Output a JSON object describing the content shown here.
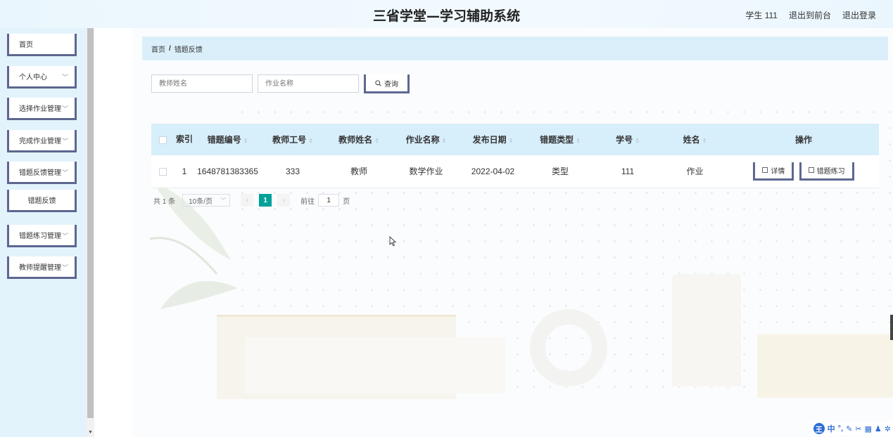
{
  "header": {
    "title": "三省学堂—学习辅助系统",
    "user_label": "学生 111",
    "back_to_front": "退出到前台",
    "logout": "退出登录"
  },
  "sidebar": {
    "items": [
      {
        "label": "首页",
        "has_chevron": false
      },
      {
        "label": "个人中心",
        "has_chevron": true
      },
      {
        "label": "选择作业管理",
        "has_chevron": true
      },
      {
        "label": "完成作业管理",
        "has_chevron": true
      },
      {
        "label": "错题反馈管理",
        "has_chevron": true
      },
      {
        "label": "错题反馈",
        "sub": true
      },
      {
        "label": "错题练习管理",
        "has_chevron": true
      },
      {
        "label": "教师提醒管理",
        "has_chevron": true
      }
    ]
  },
  "breadcrumb": {
    "home": "首页",
    "separator": "/",
    "current": "错题反馈"
  },
  "search": {
    "teacher_name_placeholder": "教师姓名",
    "homework_name_placeholder": "作业名称",
    "button_label": "查询"
  },
  "table": {
    "columns": [
      "索引",
      "错题编号",
      "教师工号",
      "教师姓名",
      "作业名称",
      "发布日期",
      "错题类型",
      "学号",
      "姓名",
      "操作"
    ],
    "rows": [
      {
        "index": "1",
        "error_no": "1648781383365",
        "teacher_id": "333",
        "teacher_name": "教师",
        "homework_name": "数学作业",
        "publish_date": "2022-04-02",
        "error_type": "类型",
        "student_no": "111",
        "name": "作业"
      }
    ],
    "actions": {
      "detail": "详情",
      "practice": "错题练习"
    }
  },
  "pagination": {
    "total": "共 1 条",
    "page_size": "10条/页",
    "current_page": "1",
    "goto_label": "前往",
    "goto_value": "1",
    "page_unit": "页"
  },
  "ime": {
    "lang": "中"
  },
  "colors": {
    "accent_border": "#5d6790",
    "header_bg": "#eaf6fd",
    "table_header_bg": "#d7eefb",
    "page_active": "#00a09b"
  }
}
